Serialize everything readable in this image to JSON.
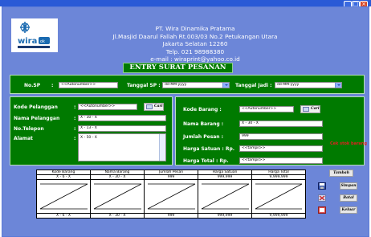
{
  "header": {
    "company_name": "PT. Wira Dinamika Pratama",
    "address_line1": "Jl.Masjid Daarul Fallah Rt.003/03 No.2 Petukangan Utara",
    "address_line2": "Jakarta Selatan 12260",
    "phone": "Telp. 021 98988380",
    "email": "e-mail : wiraprint@yahoo.co.id",
    "logo_text": "wira",
    "logo_sub": "ok"
  },
  "title": "ENTRY SURAT PESANAN",
  "top_panel": {
    "no_sp_label": "No.SP",
    "colon": ":",
    "no_sp_value": "<<Autonumber>>",
    "tgl_sp_label": "Tanggal SP :",
    "tgl_sp_value": "dd-MM-yyyy",
    "tgl_jadi_label": "Tanggal Jadi :",
    "tgl_jadi_value": "dd-MM-yyyy"
  },
  "customer": {
    "kode_label": "Kode Pelanggan",
    "kode_value": "<<Autonumber>>",
    "nama_label": "Nama Pelanggan",
    "nama_value": "X - 30 - X",
    "telp_label": "No.Telepon",
    "telp_value": "X - 13 - X",
    "alamat_label": "Alamat",
    "alamat_value": "X - 50 - X",
    "cari_label": "Cari",
    "colon": ":"
  },
  "item": {
    "kode_label": "Kode Barang :",
    "kode_value": "<<Autonumber>>",
    "nama_label": "Nama Barang :",
    "nama_value": "X - 30 - X",
    "jumlah_label": "Jumlah Pesan :",
    "jumlah_value": "999",
    "harga_label": "Harga Satuan : Rp.",
    "harga_value": "<<tampil>>",
    "total_label": "Harga Total   : Rp.",
    "total_value": "<<tampil>>",
    "cari_label": "Cari",
    "warning": "Cek stok barang"
  },
  "table": {
    "columns": [
      {
        "header": "Kode Barang",
        "first": "X - 6 - X",
        "last": "X - 6 - X"
      },
      {
        "header": "Nama Barang",
        "first": "X - 30 - X",
        "last": "X - 30 - X"
      },
      {
        "header": "Jumlah Pesan",
        "first": "999",
        "last": "999"
      },
      {
        "header": "Harga Satuan",
        "first": "999,999",
        "last": "999,999"
      },
      {
        "header": "Harga Total",
        "first": "9,999,999",
        "last": "9,999,999"
      }
    ]
  },
  "actions": {
    "tambah": "Tambah",
    "simpan": "Simpan",
    "batal": "Batal",
    "keluar": "Keluar"
  },
  "icons": {
    "minimize": "minimize-icon",
    "maximize": "maximize-icon",
    "close": "close-icon",
    "search": "search-icon",
    "save": "floppy-icon",
    "cancel": "cancel-icon",
    "exit": "exit-icon"
  },
  "colors": {
    "background": "#6c86d8",
    "panel": "#007a00",
    "titlebar": "#2a5ad6",
    "warning": "#e02020"
  }
}
